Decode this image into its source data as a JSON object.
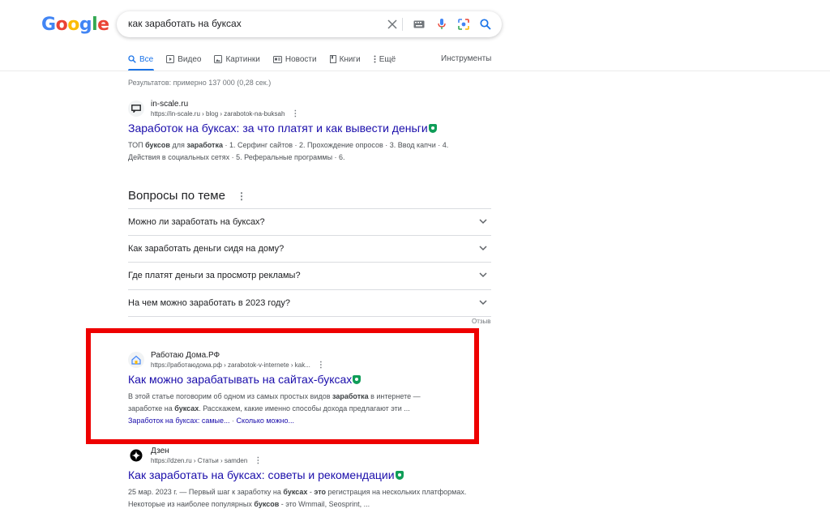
{
  "logo": {
    "letters": [
      "G",
      "o",
      "o",
      "g",
      "l",
      "e"
    ]
  },
  "search": {
    "query": "как заработать на буксах"
  },
  "tabs": [
    {
      "label": "Все",
      "icon": "search-icon"
    },
    {
      "label": "Видео",
      "icon": "play-icon"
    },
    {
      "label": "Картинки",
      "icon": "image-icon"
    },
    {
      "label": "Новости",
      "icon": "news-icon"
    },
    {
      "label": "Книги",
      "icon": "book-icon"
    },
    {
      "label": "Ещё",
      "icon": "more-vert-icon"
    }
  ],
  "tools_label": "Инструменты",
  "stats": "Результатов: примерно 137 000 (0,28 сек.)",
  "results": [
    {
      "site": "in-scale.ru",
      "url": "https://in-scale.ru › blog › zarabotok-na-buksah",
      "title": "Заработок на буксах: за что платят и как вывести деньги",
      "snippet_parts": [
        {
          "t": "ТОП ",
          "b": false
        },
        {
          "t": "буксов",
          "b": true
        },
        {
          "t": " для ",
          "b": false
        },
        {
          "t": "заработка",
          "b": true
        },
        {
          "t": " · 1. Серфинг сайтов · 2. Прохождение опросов · 3. Ввод капчи · 4. Действия в социальных сетях · 5. Реферальные программы · 6.",
          "b": false
        }
      ]
    },
    {
      "site": "Работаю Дома.РФ",
      "url": "https://работаюдома.рф › zarabotok-v-internete › kak...",
      "title": "Как можно зарабатывать на сайтах-буксах",
      "snippet_parts": [
        {
          "t": "В этой статье поговорим об одном из самых простых видов ",
          "b": false
        },
        {
          "t": "заработка",
          "b": true
        },
        {
          "t": " в интернете — заработке на ",
          "b": false
        },
        {
          "t": "буксах",
          "b": true
        },
        {
          "t": ". Расскажем, какие именно способы дохода предлагают эти ...",
          "b": false
        }
      ],
      "sitelinks": [
        "Заработок на буксах: самые...",
        "Сколько можно..."
      ],
      "sitelink_sep": " · "
    },
    {
      "site": "Дзен",
      "url": "https://dzen.ru › Статьи › samden",
      "title": "Как заработать на буксах: советы и рекомендации",
      "snippet_parts": [
        {
          "t": "25 мар. 2023 г. — Первый шаг к заработку на ",
          "b": false
        },
        {
          "t": "буксах",
          "b": true
        },
        {
          "t": " - ",
          "b": false
        },
        {
          "t": "это",
          "b": true
        },
        {
          "t": " регистрация на нескольких платформах. Некоторые из наиболее популярных ",
          "b": false
        },
        {
          "t": "буксов",
          "b": true
        },
        {
          "t": " - это Wmmail, Seosprint, ...",
          "b": false
        }
      ]
    }
  ],
  "paa": {
    "title": "Вопросы по теме",
    "questions": [
      "Можно ли заработать на буксах?",
      "Как заработать деньги сидя на дому?",
      "Где платят деньги за просмотр рекламы?",
      "На чем можно заработать в 2023 году?"
    ],
    "feedback": "Отзыв"
  },
  "colors": {
    "link": "#1a0dab",
    "accent": "#1a73e8",
    "highlight": "#ee0000",
    "verified": "#0f9d58"
  }
}
